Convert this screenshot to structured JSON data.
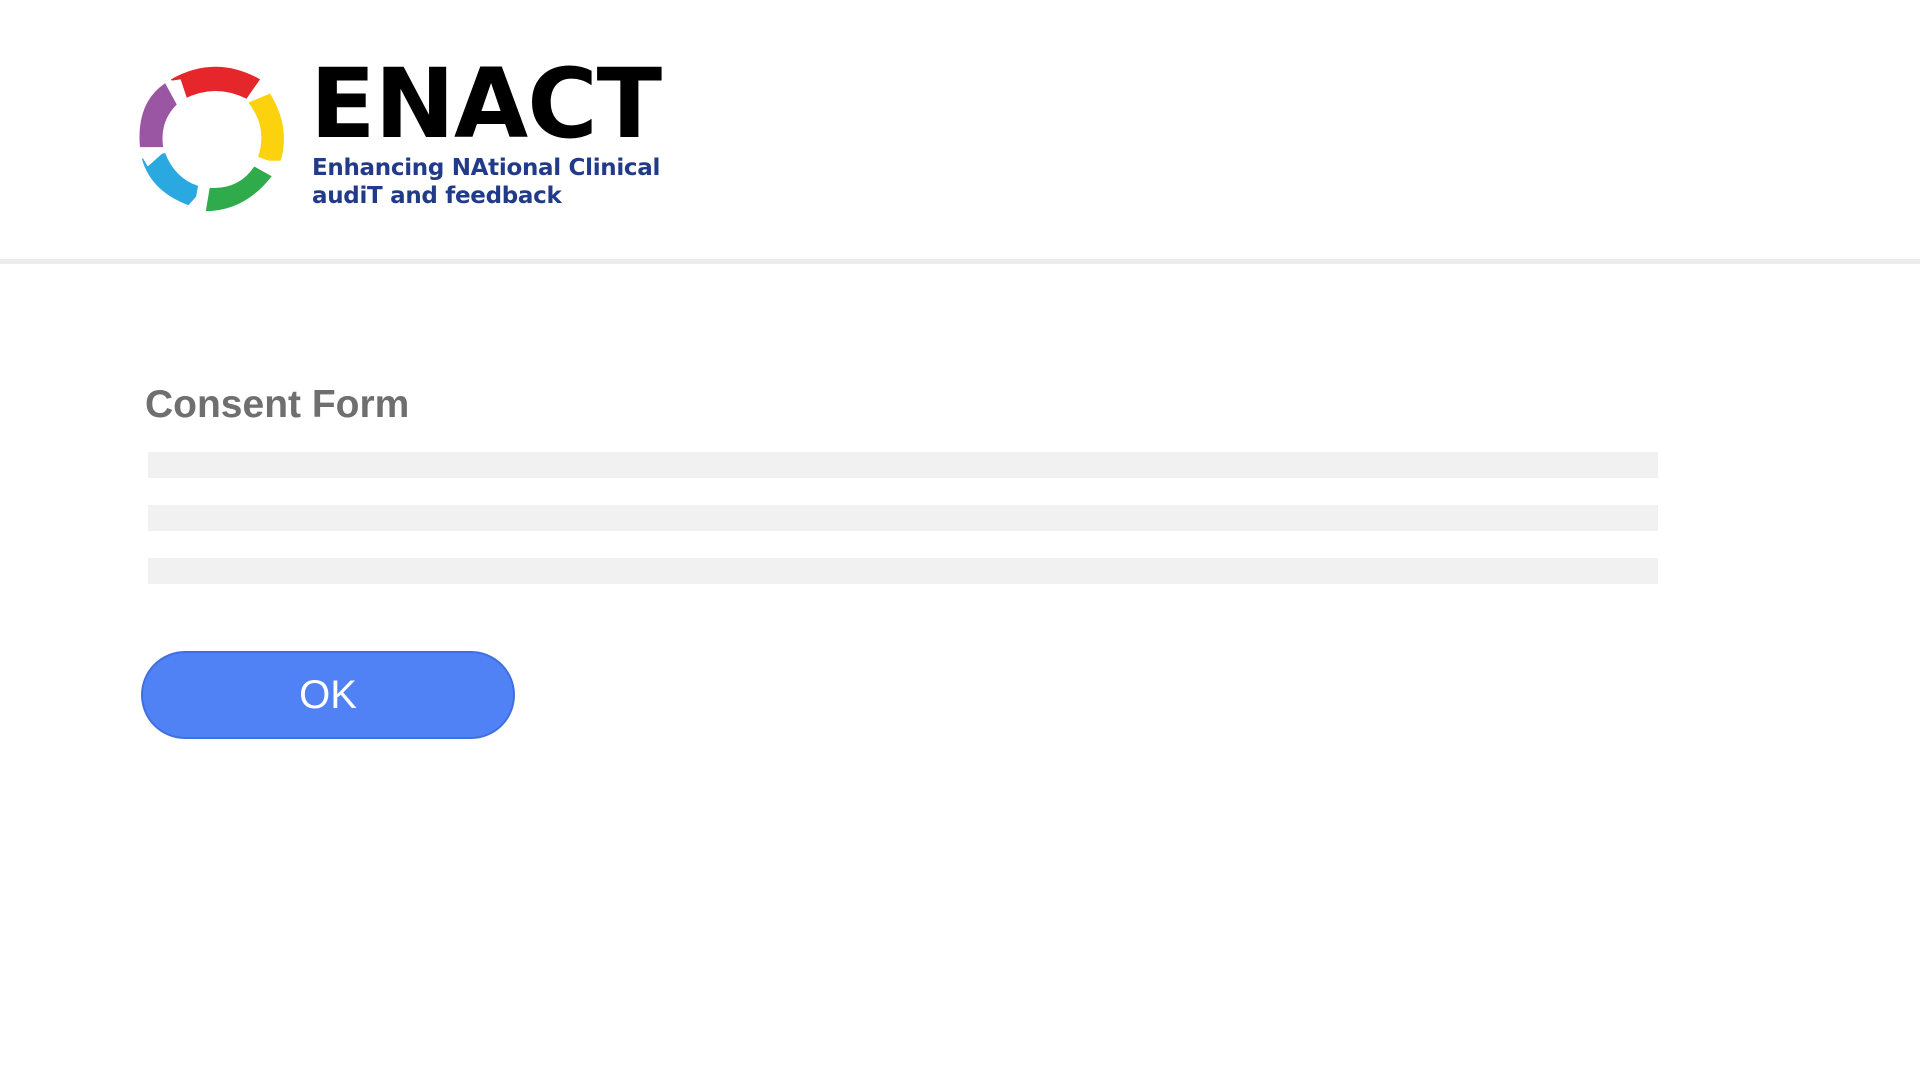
{
  "header": {
    "logo": {
      "title": "ENACT",
      "subtitle_line1": "Enhancing NAtional Clinical",
      "subtitle_line2": "audiT and feedback",
      "icon": "enact-cycle-logo-icon",
      "colors": [
        "#e5262b",
        "#fcd20f",
        "#2fab4b",
        "#2aa8e0",
        "#9b56a3"
      ]
    }
  },
  "main": {
    "title": "Consent Form",
    "placeholder_lines": 3,
    "ok_label": "OK"
  },
  "colors": {
    "title_text": "#6f6f6f",
    "button_bg": "#5082f6",
    "button_text": "#ffffff",
    "subtitle_text": "#223a8a",
    "skeleton": "#f1f1f1"
  }
}
